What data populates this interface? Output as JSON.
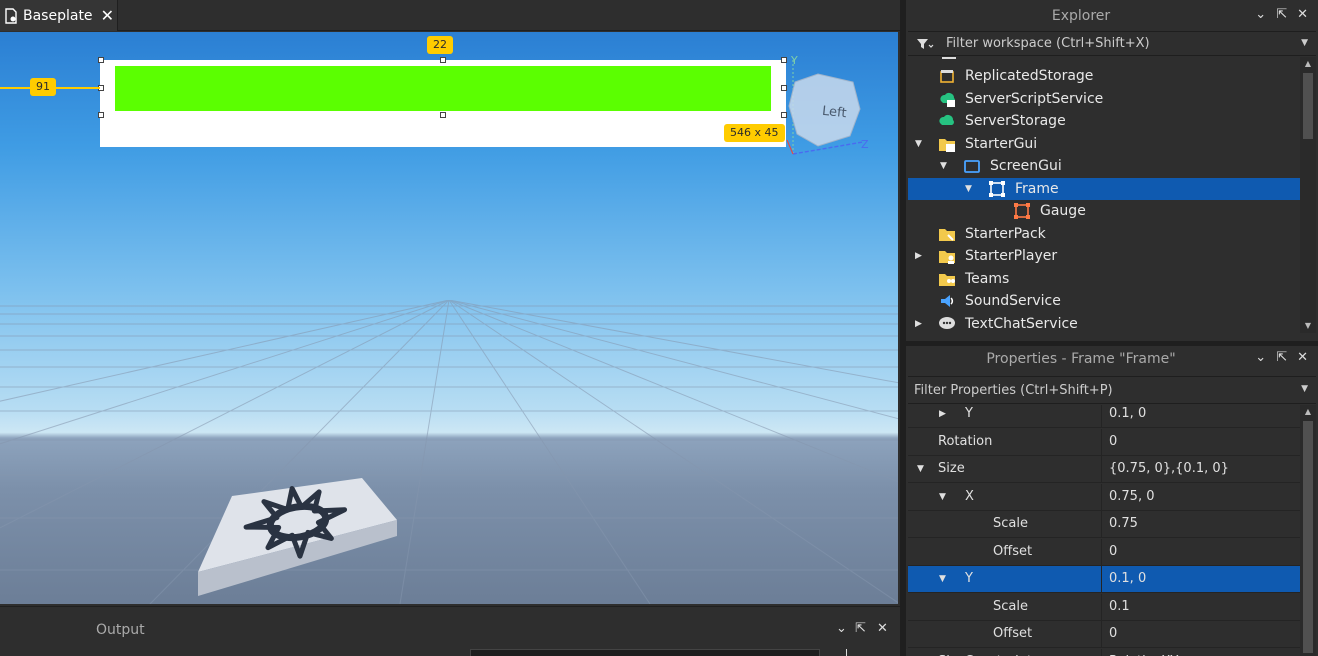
{
  "viewport": {
    "tab_label": "Baseplate",
    "tab_close": "✕",
    "badge_top": "22",
    "badge_left": "91",
    "badge_size": "546 x 45",
    "view_cube_face": "Left",
    "axis_y": "Y",
    "axis_z": "Z",
    "gauge_color": "#5bff01"
  },
  "output": {
    "title": "Output"
  },
  "explorer": {
    "title": "Explorer",
    "filter_placeholder": "Filter workspace (Ctrl+Shift+X)",
    "items": [
      {
        "label": "ReplicatedStorage",
        "icon": "replicated-storage-icon",
        "depth": 0,
        "expand": "none",
        "selected": false
      },
      {
        "label": "ServerScriptService",
        "icon": "server-script-service-icon",
        "depth": 0,
        "expand": "none",
        "selected": false
      },
      {
        "label": "ServerStorage",
        "icon": "server-storage-icon",
        "depth": 0,
        "expand": "none",
        "selected": false
      },
      {
        "label": "StarterGui",
        "icon": "starter-gui-icon",
        "depth": 0,
        "expand": "expanded",
        "selected": false
      },
      {
        "label": "ScreenGui",
        "icon": "screen-gui-icon",
        "depth": 1,
        "expand": "expanded",
        "selected": false
      },
      {
        "label": "Frame",
        "icon": "frame-icon",
        "depth": 2,
        "expand": "expanded",
        "selected": true
      },
      {
        "label": "Gauge",
        "icon": "frame-icon",
        "depth": 3,
        "expand": "none",
        "selected": false
      },
      {
        "label": "StarterPack",
        "icon": "starter-pack-icon",
        "depth": 0,
        "expand": "none",
        "selected": false
      },
      {
        "label": "StarterPlayer",
        "icon": "starter-player-icon",
        "depth": 0,
        "expand": "collapsed",
        "selected": false
      },
      {
        "label": "Teams",
        "icon": "teams-icon",
        "depth": 0,
        "expand": "none",
        "selected": false
      },
      {
        "label": "SoundService",
        "icon": "sound-service-icon",
        "depth": 0,
        "expand": "none",
        "selected": false
      },
      {
        "label": "TextChatService",
        "icon": "text-chat-service-icon",
        "depth": 0,
        "expand": "collapsed",
        "selected": false
      }
    ]
  },
  "properties": {
    "title": "Properties - Frame \"Frame\"",
    "filter_placeholder": "Filter Properties (Ctrl+Shift+P)",
    "rows": [
      {
        "name": "Y",
        "value": "0.1, 0",
        "depth": 1,
        "expand": "collapsed",
        "selected": false
      },
      {
        "name": "Rotation",
        "value": "0",
        "depth": 0,
        "expand": "none",
        "selected": false
      },
      {
        "name": "Size",
        "value": "{0.75, 0},{0.1, 0}",
        "depth": 0,
        "expand": "expanded",
        "selected": false
      },
      {
        "name": "X",
        "value": "0.75, 0",
        "depth": 1,
        "expand": "expanded",
        "selected": false
      },
      {
        "name": "Scale",
        "value": "0.75",
        "depth": 2,
        "expand": "none",
        "selected": false
      },
      {
        "name": "Offset",
        "value": "0",
        "depth": 2,
        "expand": "none",
        "selected": false
      },
      {
        "name": "Y",
        "value": "0.1, 0",
        "depth": 1,
        "expand": "expanded",
        "selected": true
      },
      {
        "name": "Scale",
        "value": "0.1",
        "depth": 2,
        "expand": "none",
        "selected": false
      },
      {
        "name": "Offset",
        "value": "0",
        "depth": 2,
        "expand": "none",
        "selected": false
      },
      {
        "name": "SizeConstraint",
        "value": "RelativeXY",
        "depth": 0,
        "expand": "none",
        "selected": false
      }
    ]
  },
  "controls": {
    "dropdown": "⌄",
    "undock": "⇱",
    "close": "✕"
  }
}
